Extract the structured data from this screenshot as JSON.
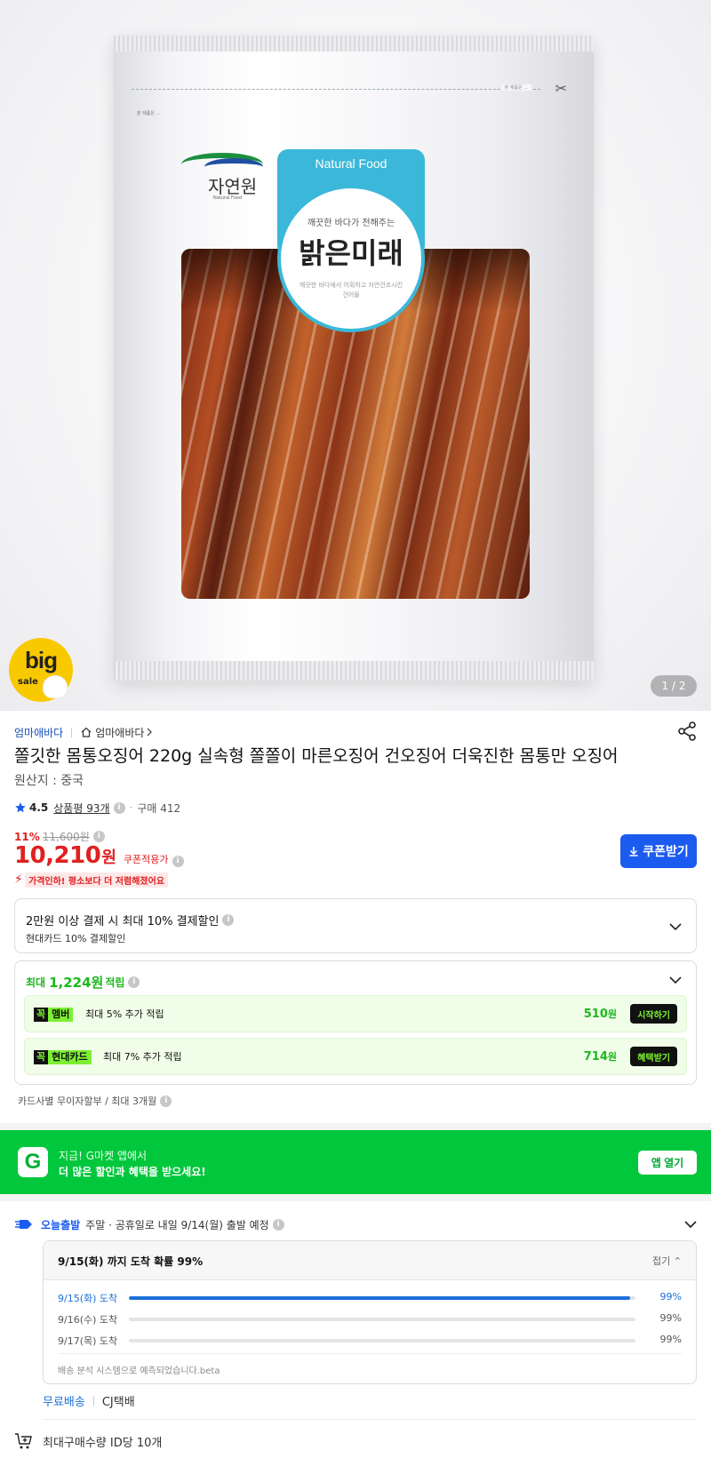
{
  "product_image": {
    "pack_top_text": "본 제품은 ...",
    "brand_logo": "자연원",
    "brand_logo_sub": "Natural Food",
    "label_top": "Natural Food",
    "label_line1": "깨끗한 바다가 전해주는",
    "label_main": "밝은미래",
    "label_desc": "깨끗한 바다에서 어획하고 자연건조시킨 건어물",
    "badge_big": "big",
    "badge_sale": "sale",
    "pager": "1 / 2"
  },
  "seller": {
    "name": "엄마애바다",
    "shop_link": "엄마애바다"
  },
  "product": {
    "title": "쫄깃한 몸통오징어 220g 실속형 쫄쫄이 마른오징어 건오징어 더욱진한 몸통만 오징어",
    "origin": "원산지 : 중국"
  },
  "rating": {
    "score": "4.5",
    "review_label": "상품평 93개",
    "purchase": "구매 412"
  },
  "price": {
    "discount_pct": "11%",
    "original": "11,600원",
    "current": "10,210",
    "unit": "원",
    "coupon_applied": "쿠폰적용가",
    "coupon_button": "쿠폰받기",
    "price_drop": "가격인하! 평소보다 더 저렴해졌어요"
  },
  "payment_benefit": {
    "title": "2만원 이상 결제 시 최대 10% 결제할인",
    "sub": "현대카드 10% 결제할인"
  },
  "points": {
    "prefix": "최대",
    "amount": "1,224원",
    "suffix": "적립",
    "rows": [
      {
        "tag_k": "꼭",
        "tag_v": "멤버",
        "desc": "최대 5% 추가 적립",
        "amount": "510",
        "unit": "원",
        "button": "시작하기"
      },
      {
        "tag_k": "꼭",
        "tag_v": "현대카드",
        "desc": "최대 7% 추가 적립",
        "amount": "714",
        "unit": "원",
        "button": "혜택받기"
      }
    ]
  },
  "installment": "카드사별 무이자할부 / 최대 3개월",
  "app_banner": {
    "logo": "G",
    "line1": "지금! G마켓 앱에서",
    "line2": "더 많은 할인과 혜택을 받으세요!",
    "button": "앱 열기"
  },
  "shipping": {
    "today_label": "오늘출발",
    "text": "주말 · 공휴일로 내일 9/14(월) 출발 예정",
    "arrival_title": "9/15(화) 까지 도착 확률 99%",
    "fold": "접기",
    "items": [
      {
        "date": "9/15(화) 도착",
        "pct": "99%",
        "fill": 0.99
      },
      {
        "date": "9/16(수) 도착",
        "pct": "99%",
        "fill": 0
      },
      {
        "date": "9/17(목) 도착",
        "pct": "99%",
        "fill": 0
      }
    ],
    "note": "배송 분석 시스템으로 예측되었습니다.beta",
    "free": "무료배송",
    "courier": "CJ택배",
    "max_buy": "최대구매수량 ID당 10개"
  },
  "colors": {
    "accent_blue": "#1b5bf0",
    "price_red": "#e02020",
    "gmarket_green": "#00c73c",
    "point_green": "#1db81d"
  }
}
